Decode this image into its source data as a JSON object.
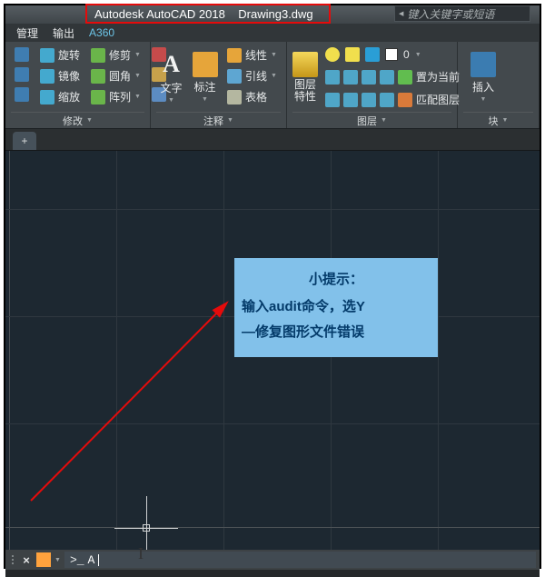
{
  "title": {
    "app_name": "Autodesk AutoCAD 2018",
    "file_name": "Drawing3.dwg",
    "search_placeholder": "键入关键字或短语"
  },
  "menu": {
    "items": [
      "管理",
      "输出",
      "A360"
    ]
  },
  "ribbon": {
    "panel_modify": {
      "title": "修改",
      "rotate": "旋转",
      "mirror": "镜像",
      "scale": "缩放",
      "trim": "修剪",
      "fillet": "圆角",
      "array": "阵列"
    },
    "panel_annotate": {
      "title": "注释",
      "text": "文字",
      "dimension": "标注",
      "linear": "线性",
      "leader": "引线",
      "table": "表格"
    },
    "panel_layer": {
      "title": "图层",
      "properties": "图层\n特性",
      "set_current": "置为当前",
      "match": "匹配图层"
    },
    "panel_block": {
      "title": "块",
      "insert": "插入"
    }
  },
  "callout": {
    "line1": "小提示：",
    "line2": "输入audit命令，选Y",
    "line3": "—修复图形文件错误"
  },
  "cmd": {
    "prompt": ">_",
    "typed": "A"
  }
}
